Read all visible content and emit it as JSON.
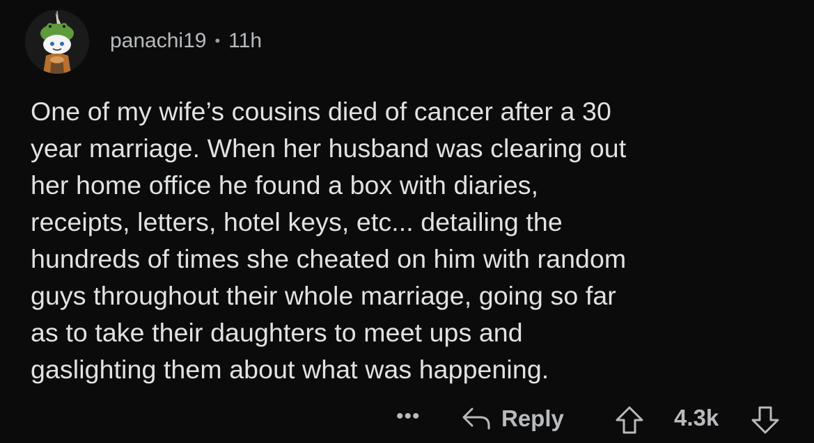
{
  "comment": {
    "username": "panachi19",
    "separator": "•",
    "timestamp": "11h",
    "avatar_icon": "snoo-avatar-icon",
    "body_lines": [
      "One of my wife’s cousins died of cancer after a 30",
      "year marriage. When her husband was clearing out",
      "her home office he found a box with diaries,",
      "receipts, letters, hotel keys, etc... detailing the",
      "hundreds of times she cheated on him with random",
      "guys throughout their whole marriage, going so far",
      "as to take their daughters to meet ups and",
      "gaslighting them about what was happening."
    ]
  },
  "actions": {
    "more_label": "•••",
    "reply_label": "Reply",
    "score": "4.3k",
    "upvote_icon": "upvote-arrow-icon",
    "downvote_icon": "downvote-arrow-icon",
    "reply_icon": "reply-arrow-icon"
  },
  "colors": {
    "background": "#0b0b0b",
    "text": "#e0e2e4",
    "meta_text": "#b8bbbe"
  }
}
